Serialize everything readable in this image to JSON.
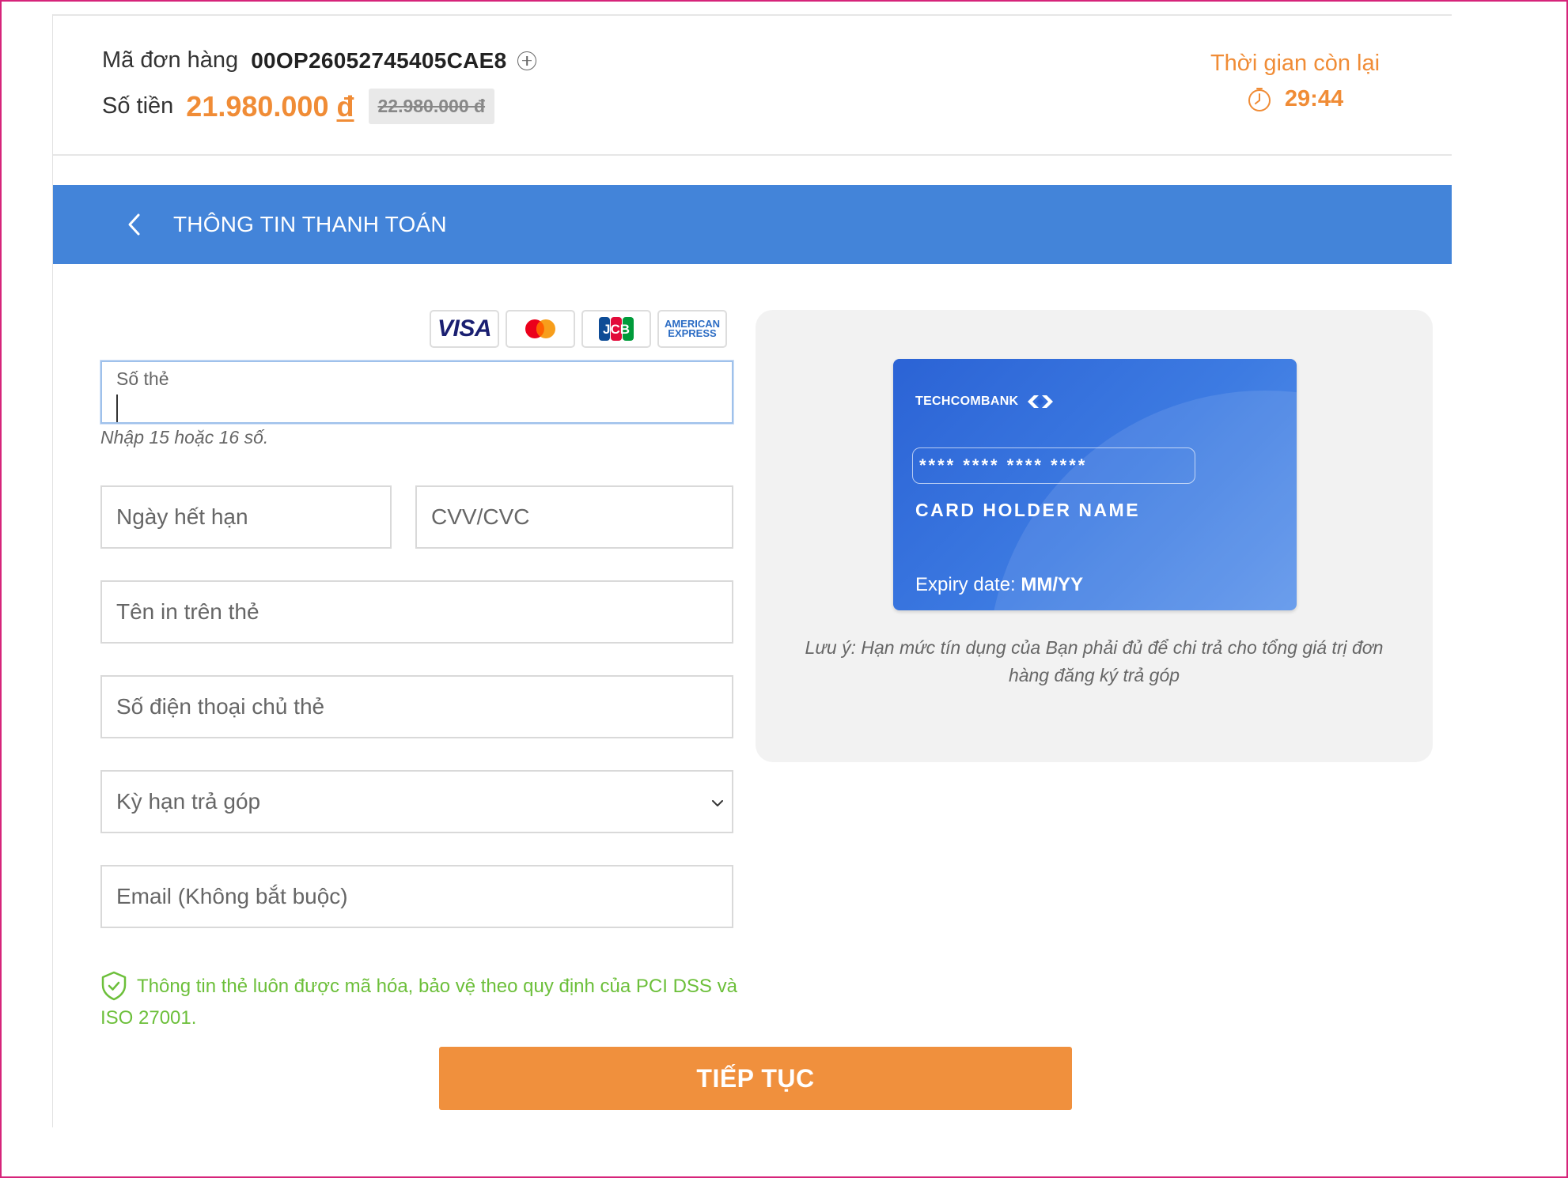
{
  "order": {
    "code_label": "Mã đơn hàng",
    "code": "00OP26052745405CAE8",
    "amount_label": "Số tiền",
    "amount_value": "21.980.000",
    "amount_currency": "đ",
    "old_amount": "22.980.000 đ"
  },
  "timer": {
    "label": "Thời gian còn lại",
    "value": "29:44"
  },
  "header_bar": {
    "title": "THÔNG TIN THANH TOÁN"
  },
  "card_brands": [
    "VISA",
    "Mastercard",
    "JCB",
    "AMERICAN EXPRESS"
  ],
  "form": {
    "card_number_label": "Số thẻ",
    "card_number_hint": "Nhập 15 hoặc 16 số.",
    "expiry_placeholder": "Ngày hết hạn",
    "cvv_placeholder": "CVV/CVC",
    "name_placeholder": "Tên in trên thẻ",
    "phone_placeholder": "Số điện thoại chủ thẻ",
    "term_placeholder": "Kỳ hạn trả góp",
    "email_placeholder": "Email (Không bắt buộc)"
  },
  "security_note": "Thông tin thẻ luôn được mã hóa, bảo vệ theo quy định của PCI DSS và ISO 27001.",
  "submit_label": "TIẾP TỤC",
  "card_preview": {
    "bank_name": "TECHCOMBANK",
    "number_mask": "**** **** **** ****",
    "holder_name": "CARD HOLDER NAME",
    "expiry_label": "Expiry date:",
    "expiry_value": "MM/YY"
  },
  "limit_note": "Lưu ý: Hạn mức tín dụng của Bạn phải đủ để chi trả cho tổng giá trị đơn hàng đăng ký trả góp",
  "colors": {
    "accent_orange": "#f08c36",
    "header_blue": "#4384d9",
    "secure_green": "#6cbf3a",
    "card_blue": "#2b63d5"
  }
}
